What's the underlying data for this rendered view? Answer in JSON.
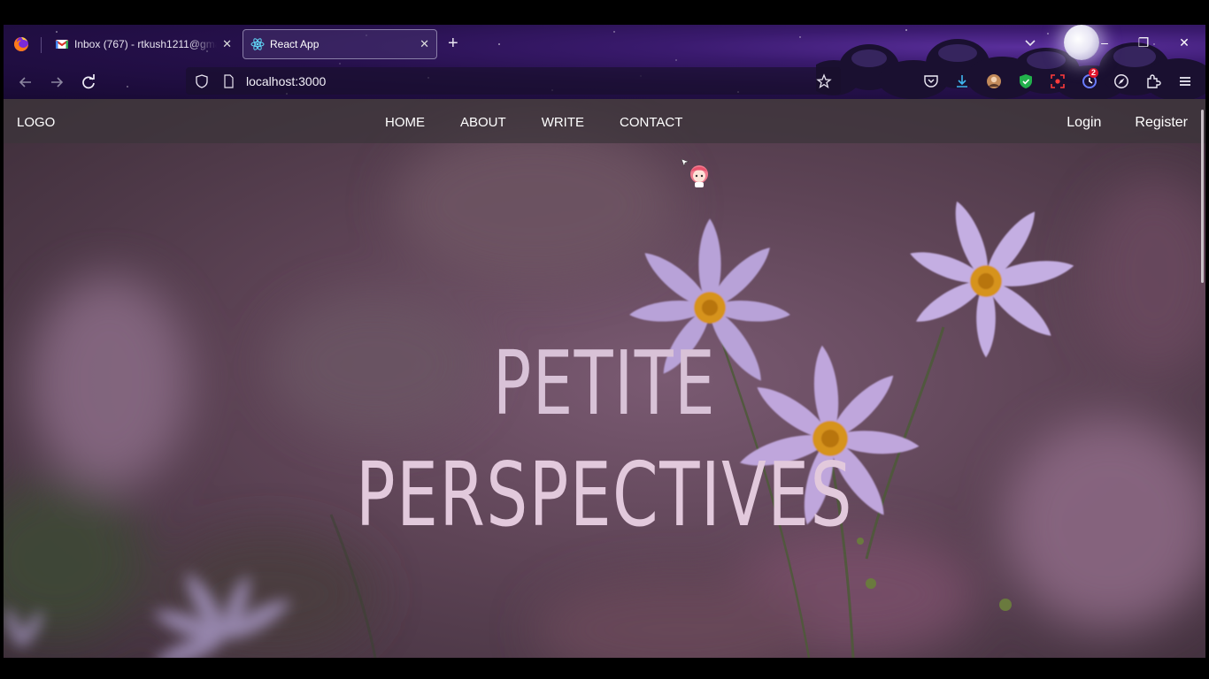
{
  "browser": {
    "tabs": [
      {
        "title": "Inbox (767) - rtkush1211@gmai",
        "icon": "gmail-icon",
        "active": false
      },
      {
        "title": "React App",
        "icon": "react-icon",
        "active": true
      }
    ],
    "url": "localhost:3000",
    "extension_badge": "2"
  },
  "site": {
    "logo": "LOGO",
    "menu": [
      "HOME",
      "ABOUT",
      "WRITE",
      "CONTACT"
    ],
    "auth": {
      "login": "Login",
      "register": "Register"
    },
    "hero": {
      "line1": "PETITE",
      "line2": "PERSPECTIVES"
    }
  },
  "colors": {
    "chrome_bg": "#25104a",
    "hero_text": "#d8c2d7",
    "nav_bg": "#3c343a",
    "flower": "#b8a0d8",
    "flower_center": "#d89a1a"
  }
}
